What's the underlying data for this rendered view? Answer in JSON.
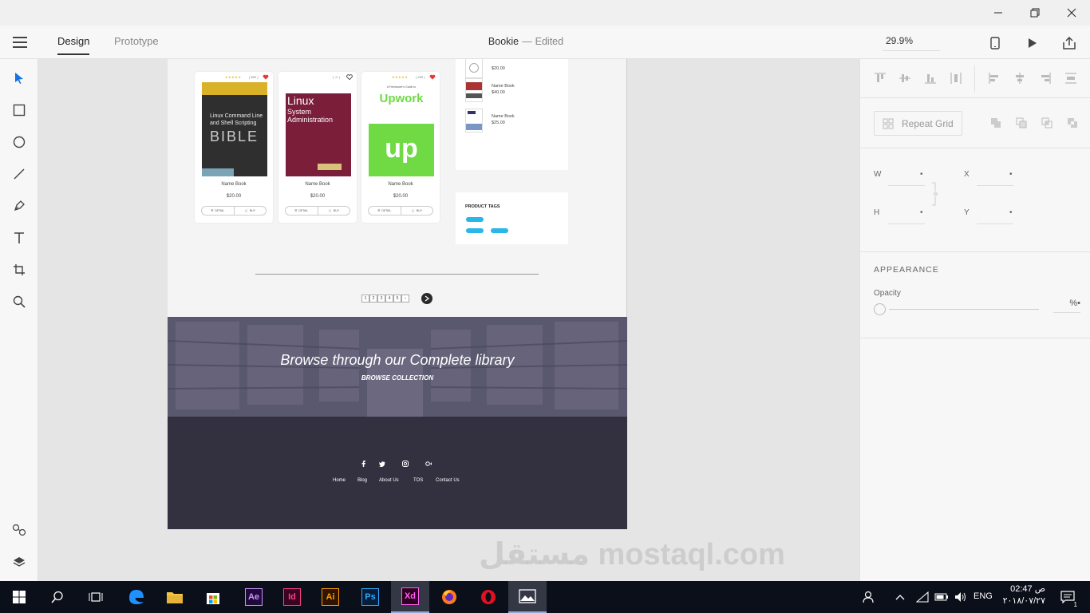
{
  "titlebar": {
    "minimize_icon": "minimize-icon",
    "maximize_icon": "restore-icon",
    "close_icon": "close-icon"
  },
  "appbar": {
    "tabs": [
      {
        "label": "Design",
        "active": true
      },
      {
        "label": "Prototype",
        "active": false
      }
    ],
    "doc_title": "Bookie",
    "doc_separator": "—",
    "doc_status": "Edited",
    "zoom": "29.9%"
  },
  "left_tools": [
    "select-tool",
    "rectangle-tool",
    "ellipse-tool",
    "line-tool",
    "pen-tool",
    "text-tool",
    "artboard-tool",
    "zoom-tool",
    "symbols-panel",
    "layers-panel"
  ],
  "artboard": {
    "books": [
      {
        "name": "Name Book",
        "price": "$20.00",
        "rating_count": "( 820 )",
        "liked": true,
        "detail_label": "DETAIL",
        "buy_label": "BUY",
        "cover_lines": [
          "Linux Command Line",
          "and Shell Scripting",
          "BIBLE"
        ]
      },
      {
        "name": "Name Book",
        "price": "$20.00",
        "rating_count": "( 0 )",
        "liked": false,
        "detail_label": "DETAIL",
        "buy_label": "BUY",
        "cover_lines": [
          "Linux",
          "System",
          "Administration"
        ]
      },
      {
        "name": "Name Book",
        "price": "$20.00",
        "rating_count": "( 230 )",
        "liked": true,
        "detail_label": "DETAIL",
        "buy_label": "BUY",
        "cover_lines": [
          "A Freelancer's Guide to",
          "Upwork",
          "up"
        ]
      }
    ],
    "recent_books": [
      {
        "name": "",
        "price": "$20.00"
      },
      {
        "name": "Name Book",
        "price": "$40.00"
      },
      {
        "name": "Name Book",
        "price": "$25.00"
      }
    ],
    "tags_title": "PRODUCT TAGS",
    "tags": [
      "",
      "",
      ""
    ],
    "pages": [
      "1",
      "2",
      "3",
      "4",
      "5",
      "›"
    ],
    "banner_title": "Browse through our Complete library",
    "banner_subtitle": "BROWSE COLLECTION",
    "footer_links": [
      "Home",
      "Blog",
      "About Us",
      "TOS",
      "Contact Us"
    ],
    "social_icons": [
      "facebook-icon",
      "twitter-icon",
      "instagram-icon",
      "google-plus-icon"
    ]
  },
  "right_panel": {
    "repeat_grid_label": "Repeat Grid",
    "fields": [
      {
        "label": "W",
        "value": "•"
      },
      {
        "label": "X",
        "value": "•"
      },
      {
        "label": "H",
        "value": "•"
      },
      {
        "label": "Y",
        "value": "•"
      }
    ],
    "appearance_title": "APPEARANCE",
    "opacity_label": "Opacity",
    "opacity_value": "%•"
  },
  "taskbar": {
    "apps": [
      "Ae",
      "Id",
      "Ai",
      "Ps",
      "Xd"
    ],
    "language": "ENG",
    "time": "02:47 ص",
    "date": "٢٠١٨/٠٧/٢٧",
    "notification_count": "1"
  },
  "watermark": "مستقل mostaql.com",
  "colors": {
    "accent_blue": "#1473e6",
    "footer_bg": "#33303f",
    "tag_blue": "#29b6e8",
    "star_yellow": "#e5b800",
    "heart_red": "#e53935"
  }
}
